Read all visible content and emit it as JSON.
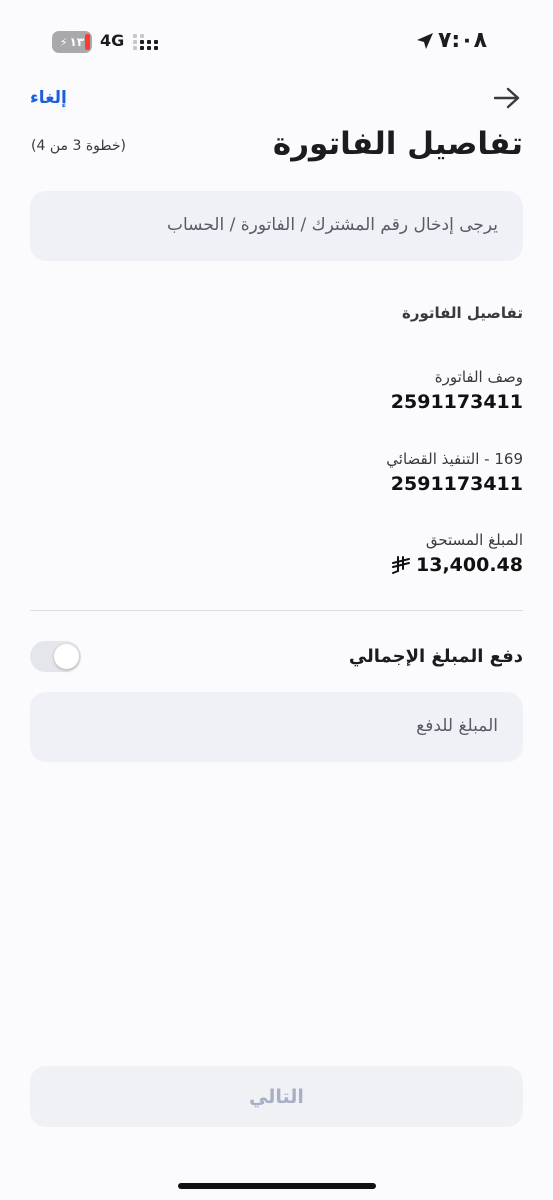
{
  "status_bar": {
    "battery_level": "١٣",
    "network": "4G",
    "time": "٧:٠٨"
  },
  "header": {
    "cancel_label": "إلغاء",
    "title": "تفاصيل الفاتورة",
    "step": "(خطوة 3 من 4)"
  },
  "subscriber_field": {
    "placeholder": "يرجى إدخال رقم المشترك / الفاتورة / الحساب"
  },
  "bill_details": {
    "heading": "تفاصيل الفاتورة",
    "description_label": "وصف الفاتورة",
    "description_value": "2591173411",
    "service_label": "169 - التنفيذ القضائي",
    "service_value": "2591173411",
    "amount_due_label": "المبلغ المستحق",
    "amount_due_value": "13,400.48",
    "currency_symbol": "⃁"
  },
  "pay_total": {
    "label": "دفع المبلغ الإجمالي",
    "enabled": false
  },
  "amount_field": {
    "placeholder": "المبلغ للدفع"
  },
  "footer": {
    "next_label": "التالي"
  },
  "colors": {
    "accent": "#1c5fd9",
    "field_bg": "#f0f1f6",
    "disabled_text": "#a7b0c4",
    "battery_low": "#ff3b30"
  },
  "icons": [
    "location-arrow-icon",
    "arrow-right-icon",
    "riyal-icon",
    "signal-dots-icon",
    "battery-icon"
  ]
}
